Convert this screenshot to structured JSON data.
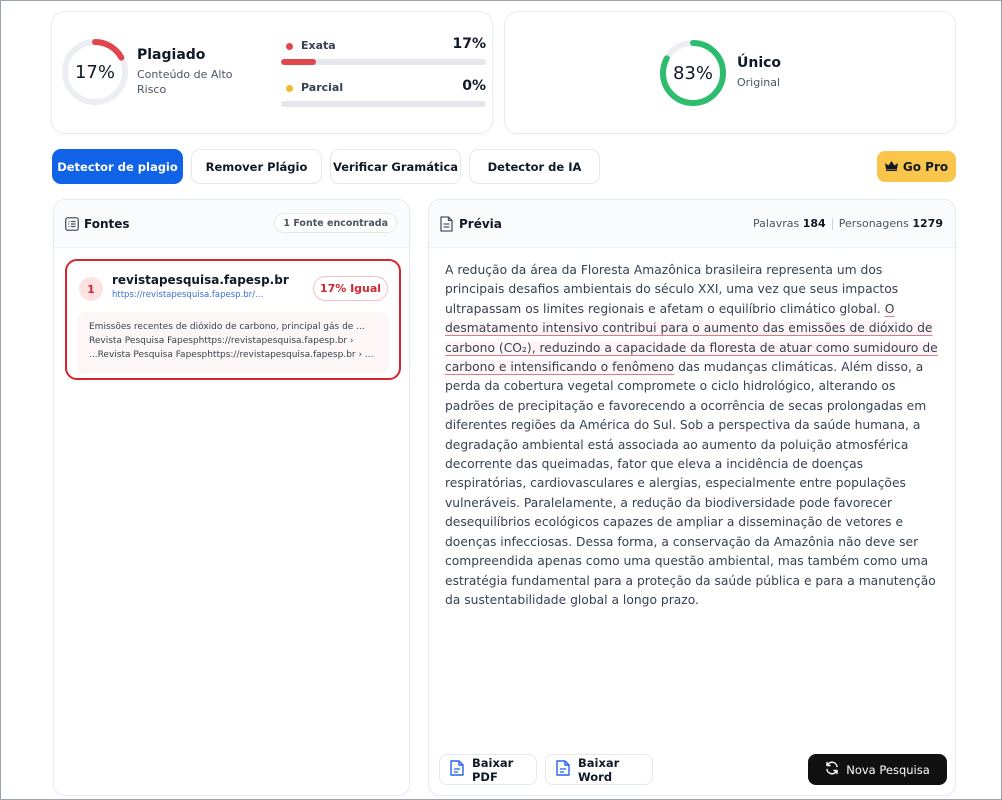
{
  "summary": {
    "plagiarism": {
      "percent_label": "17%",
      "percent_value": 17,
      "title": "Plagiado",
      "subtitle": "Conteúdo de Alto Risco",
      "ring_color": "#e0474c"
    },
    "exata": {
      "label": "Exata",
      "value_label": "17%",
      "value": 17,
      "color": "#e0474c"
    },
    "parcial": {
      "label": "Parcial",
      "value_label": "0%",
      "value": 0,
      "color": "#f5b82e"
    },
    "unique": {
      "percent_label": "83%",
      "percent_value": 83,
      "title": "Único",
      "subtitle": "Original",
      "ring_color": "#2ebd6e"
    }
  },
  "tabs": [
    {
      "label": "Detector de plagio",
      "active": true
    },
    {
      "label": "Remover Plágio",
      "active": false
    },
    {
      "label": "Verificar Gramática",
      "active": false
    },
    {
      "label": "Detector de IA",
      "active": false
    }
  ],
  "go_pro": {
    "label": "Go Pro",
    "icon": "crown-icon"
  },
  "sources": {
    "title": "Fontes",
    "badge": "1 Fonte encontrada",
    "items": [
      {
        "number": "1",
        "domain": "revistapesquisa.fapesp.br",
        "url": "https://revistapesquisa.fapesp.br/emi...",
        "match": "17% Igual",
        "snippet": [
          "Emissões recentes de dióxido de carbono, principal gás de ...",
          "Revista Pesquisa Fapesphttps://revistapesquisa.fapesp.br ›",
          "...Revista Pesquisa Fapesphttps://revistapesquisa.fapesp.br › ..."
        ]
      }
    ]
  },
  "preview": {
    "title": "Prévia",
    "words_label": "Palavras",
    "words_value": "184",
    "chars_label": "Personagens",
    "chars_value": "1279",
    "text_before": "A redução da área da Floresta Amazônica brasileira representa um dos principais desafios ambientais do século XXI, uma vez que seus impactos ultrapassam os limites regionais e afetam o equilíbrio climático global. ",
    "text_highlight": "O desmatamento intensivo contribui para o aumento das emissões de dióxido de carbono (CO₂), reduzindo a capacidade da floresta de atuar como sumidouro de carbono e intensificando o fenômeno",
    "text_after": " das mudanças climáticas. Além disso, a perda da cobertura vegetal compromete o ciclo hidrológico, alterando os padrões de precipitação e favorecendo a ocorrência de secas prolongadas em diferentes regiões da América do Sul. Sob a perspectiva da saúde humana, a degradação ambiental está associada ao aumento da poluição atmosférica decorrente das queimadas, fator que eleva a incidência de doenças respiratórias, cardiovasculares e alergias, especialmente entre populações vulneráveis. Paralelamente, a redução da biodiversidade pode favorecer desequilíbrios ecológicos capazes de ampliar a disseminação de vetores e doenças infecciosas. Dessa forma, a conservação da Amazônia não deve ser compreendida apenas como uma questão ambiental, mas também como uma estratégia fundamental para a proteção da saúde pública e para a manutenção da sustentabilidade global a longo prazo."
  },
  "actions": {
    "pdf_label": "Baixar PDF",
    "word_label": "Baixar Word",
    "new_label": "Nova Pesquisa"
  }
}
